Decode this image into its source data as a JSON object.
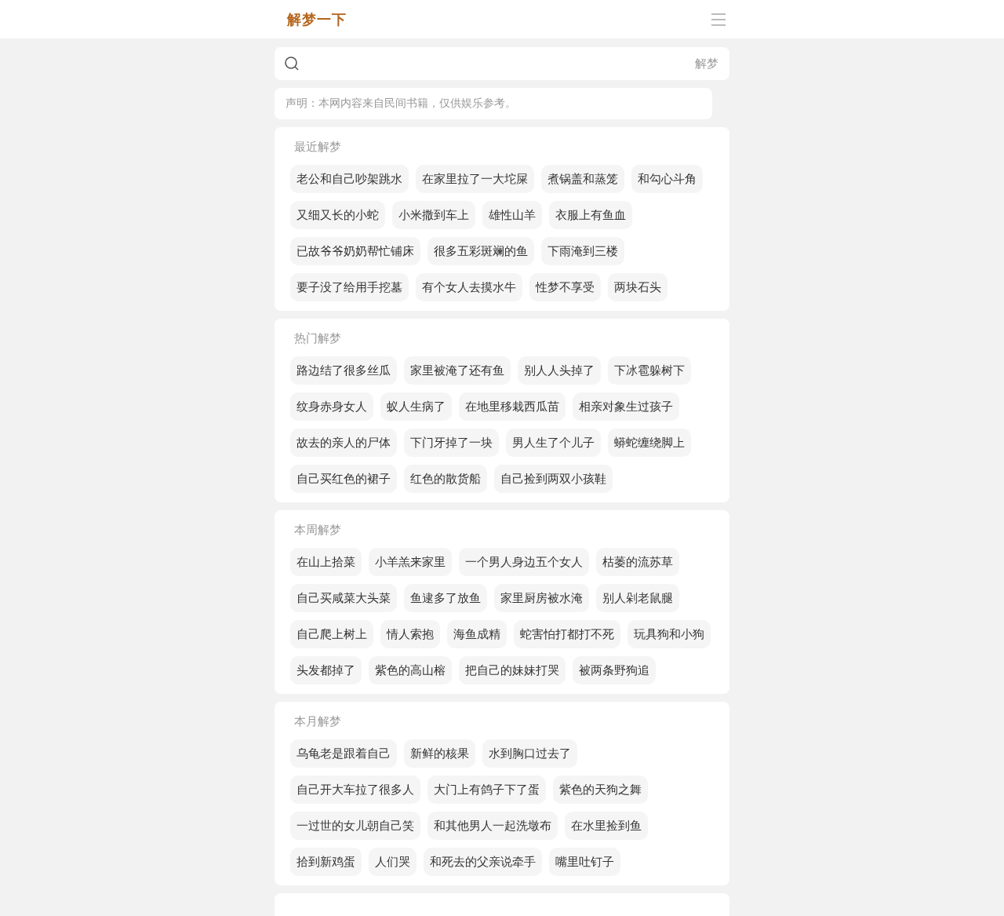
{
  "header": {
    "logo": "解梦一下"
  },
  "search": {
    "button": "解梦"
  },
  "notice": "声明：本网内容来自民间书籍，仅供娱乐参考。",
  "sections": [
    {
      "title": "最近解梦",
      "tags": [
        "老公和自己吵架跳水",
        "在家里拉了一大坨屎",
        "煮锅盖和蒸笼",
        "和勾心斗角",
        "又细又长的小蛇",
        "小米撒到车上",
        "雄性山羊",
        "衣服上有鱼血",
        "已故爷爷奶奶帮忙铺床",
        "很多五彩斑斓的鱼",
        "下雨淹到三楼",
        "要子没了给用手挖墓",
        "有个女人去摸水牛",
        "性梦不享受",
        "两块石头"
      ]
    },
    {
      "title": "热门解梦",
      "tags": [
        "路边结了很多丝瓜",
        "家里被淹了还有鱼",
        "别人人头掉了",
        "下冰雹躲树下",
        "纹身赤身女人",
        "蚁人生病了",
        "在地里移栽西瓜苗",
        "相亲对象生过孩子",
        "故去的亲人的尸体",
        "下门牙掉了一块",
        "男人生了个儿子",
        "蟒蛇缠绕脚上",
        "自己买红色的裙子",
        "红色的散货船",
        "自己捡到两双小孩鞋"
      ]
    },
    {
      "title": "本周解梦",
      "tags": [
        "在山上拾菜",
        "小羊羔来家里",
        "一个男人身边五个女人",
        "枯萎的流苏草",
        "自己买咸菜大头菜",
        "鱼逮多了放鱼",
        "家里厨房被水淹",
        "别人剁老鼠腿",
        "自己爬上树上",
        "情人索抱",
        "海鱼成精",
        "蛇害怕打都打不死",
        "玩具狗和小狗",
        "头发都掉了",
        "紫色的高山榕",
        "把自己的妹妹打哭",
        "被两条野狗追"
      ]
    },
    {
      "title": "本月解梦",
      "tags": [
        "乌龟老是跟着自己",
        "新鲜的核果",
        "水到胸口过去了",
        "自己开大车拉了很多人",
        "大门上有鸽子下了蛋",
        "紫色的天狗之舞",
        "一过世的女儿朝自己笑",
        "和其他男人一起洗墩布",
        "在水里捡到鱼",
        "拾到新鸡蛋",
        "人们哭",
        "和死去的父亲说牵手",
        "嘴里吐钉子"
      ]
    }
  ]
}
